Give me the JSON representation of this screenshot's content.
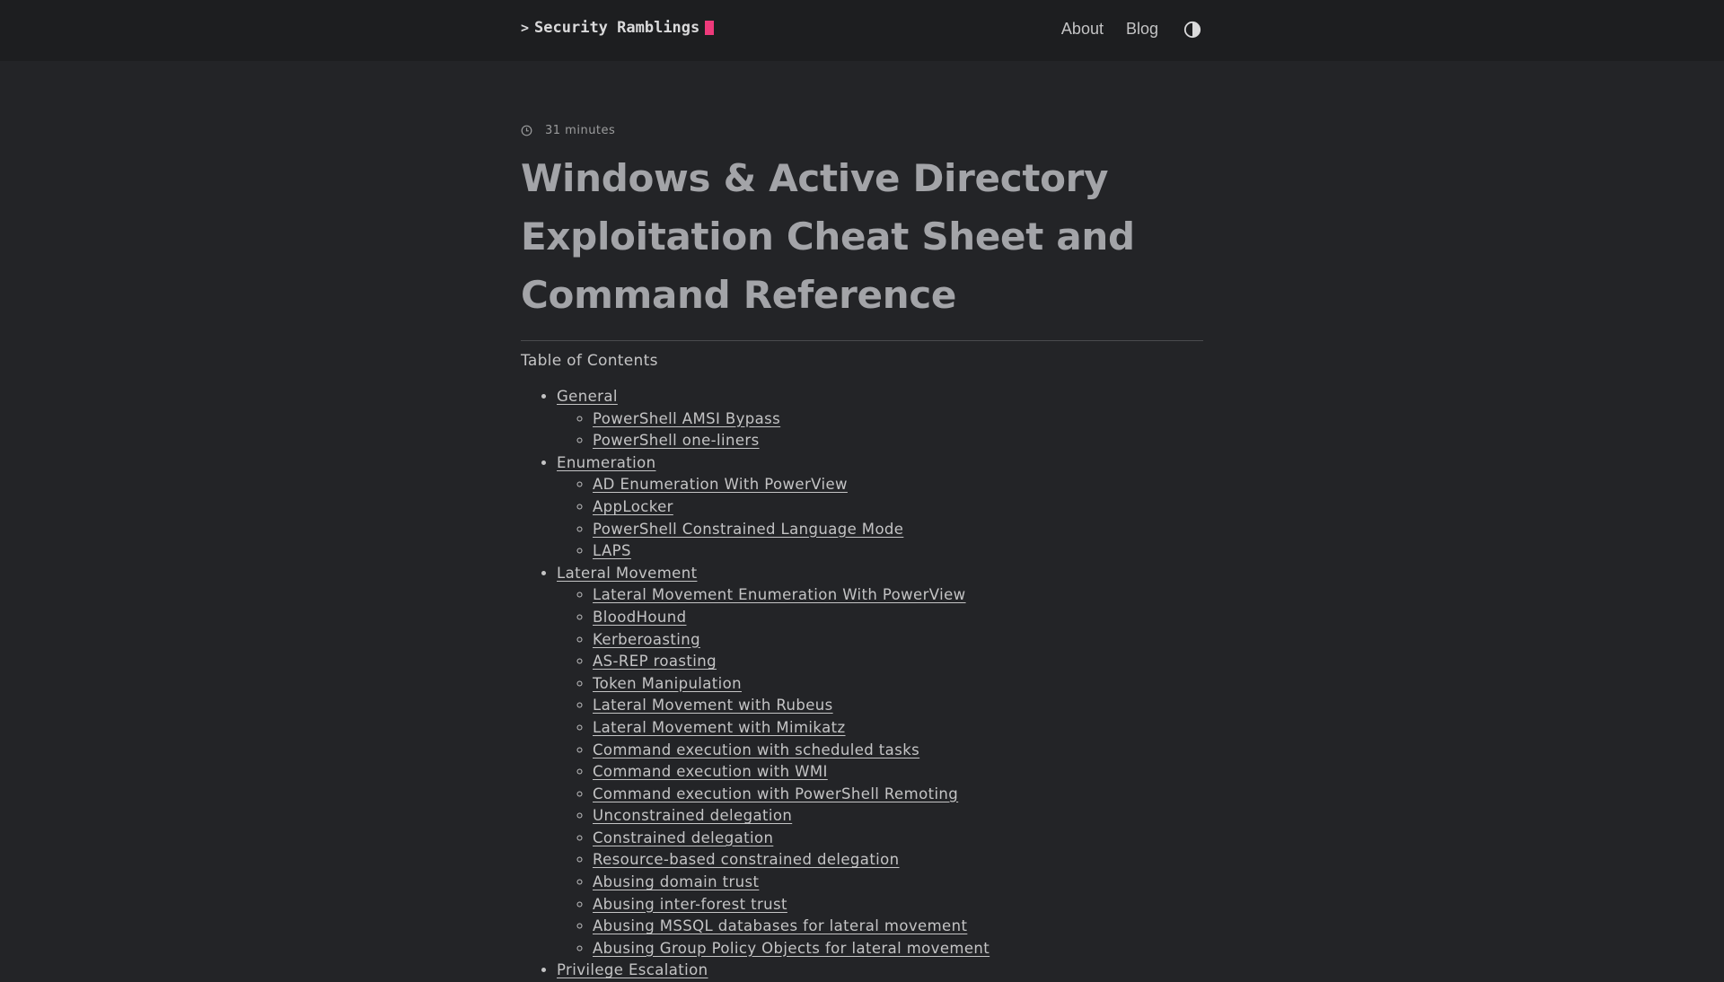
{
  "header": {
    "logo_prompt": ">",
    "logo_text": "Security Ramblings",
    "nav": [
      {
        "label": "About"
      },
      {
        "label": "Blog"
      }
    ]
  },
  "post": {
    "reading_time": "31 minutes",
    "title": "Windows & Active Directory Exploitation Cheat Sheet and Command Reference"
  },
  "toc": {
    "heading": "Table of Contents",
    "sections": [
      {
        "label": "General",
        "items": [
          "PowerShell AMSI Bypass",
          "PowerShell one-liners"
        ]
      },
      {
        "label": "Enumeration",
        "items": [
          "AD Enumeration With PowerView",
          "AppLocker",
          "PowerShell Constrained Language Mode",
          "LAPS"
        ]
      },
      {
        "label": "Lateral Movement",
        "items": [
          "Lateral Movement Enumeration With PowerView",
          "BloodHound",
          "Kerberoasting",
          "AS-REP roasting",
          "Token Manipulation",
          "Lateral Movement with Rubeus",
          "Lateral Movement with Mimikatz",
          "Command execution with scheduled tasks",
          "Command execution with WMI",
          "Command execution with PowerShell Remoting",
          "Unconstrained delegation",
          "Constrained delegation",
          "Resource-based constrained delegation",
          "Abusing domain trust",
          "Abusing inter-forest trust",
          "Abusing MSSQL databases for lateral movement",
          "Abusing Group Policy Objects for lateral movement"
        ]
      },
      {
        "label": "Privilege Escalation",
        "items": []
      }
    ]
  },
  "icons": {
    "clock": "clock-icon",
    "theme": "contrast-icon"
  },
  "colors": {
    "background": "#232427",
    "header_background": "#1d1e20",
    "cursor_accent": "#ee3a7b",
    "title": "#a3a4a8",
    "text": "#c4c4c5"
  }
}
